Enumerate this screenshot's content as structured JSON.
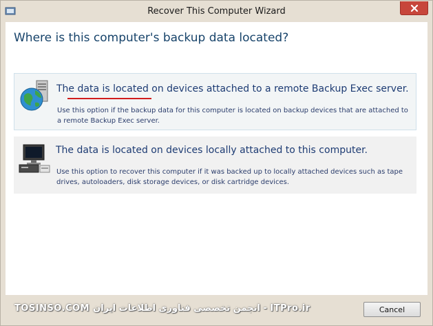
{
  "window": {
    "title": "Recover This Computer Wizard"
  },
  "page": {
    "heading": "Where is this computer's backup data located?"
  },
  "options": [
    {
      "title": "The data is located on devices attached to a remote Backup Exec server.",
      "description": "Use this option if the backup data for this computer is located on backup devices that are attached to a remote Backup Exec server.",
      "icon": "globe-server-icon",
      "selected": true
    },
    {
      "title": "The data is located on devices locally attached to this computer.",
      "description": "Use this option to recover this computer if it was backed up to locally attached devices such as tape drives, autoloaders, disk storage devices, or disk cartridge devices.",
      "icon": "local-computer-icon",
      "selected": false
    }
  ],
  "footer": {
    "watermark": "TOSINSO.COM انجمن تخصصی فناوری اطلاعات ایران - ITPro.ir",
    "cancel_label": "Cancel"
  },
  "colors": {
    "heading": "#17436a",
    "option_title": "#1d3b73",
    "close_button": "#c7463b",
    "annotation_underline": "#d11c1c"
  }
}
